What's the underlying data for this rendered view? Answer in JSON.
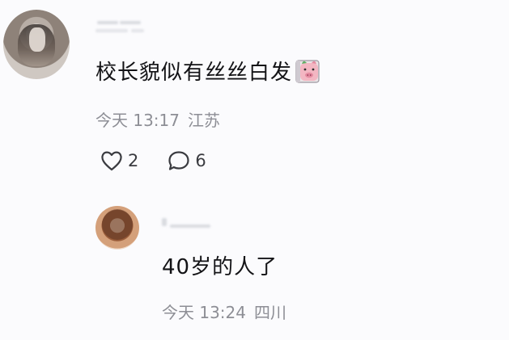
{
  "comment": {
    "content": "校长貌似有丝丝白发",
    "emoji": "pig-face-emoji",
    "time": "今天 13:17",
    "location": "江苏",
    "likes": "2",
    "replies": "6"
  },
  "reply": {
    "content": "40岁的人了",
    "time": "今天 13:24",
    "location": "四川"
  },
  "colors": {
    "background": "#fbfbfd",
    "text": "#131316",
    "meta": "#8d8e95"
  }
}
